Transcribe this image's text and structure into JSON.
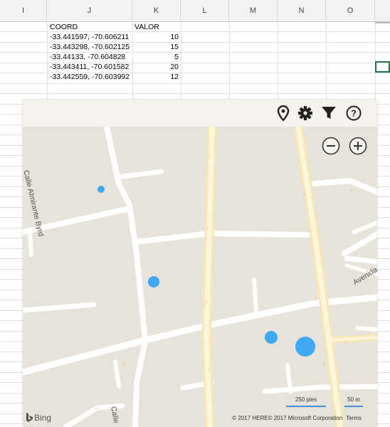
{
  "sheet": {
    "columns": [
      "I",
      "J",
      "K",
      "L",
      "M",
      "N",
      "O"
    ],
    "table": {
      "headers": [
        "COORD",
        "VALOR"
      ],
      "rows": [
        {
          "coord": "-33.441597, -70.606211",
          "valor": "10"
        },
        {
          "coord": "-33.443298, -70.602125",
          "valor": "15"
        },
        {
          "coord": "-33.44133, -70.604828",
          "valor": "5"
        },
        {
          "coord": "-33.443411, -70.601582",
          "valor": "20"
        },
        {
          "coord": "-33.442559, -70.603992",
          "valor": "12"
        }
      ]
    }
  },
  "map": {
    "toolbar_icons": [
      "map-pin-icon",
      "gear-icon",
      "filter-icon",
      "help-icon"
    ],
    "zoom_icons": [
      "zoom-out-icon",
      "zoom-in-icon"
    ],
    "street_labels": {
      "almirante": "Calle Almirante Byrd",
      "avenida": "Avenida D",
      "calle_bottom": "Calle"
    },
    "bubble_values": [
      10,
      15,
      5,
      20,
      12
    ],
    "scale": {
      "feet": "250 pies",
      "meters": "50 m"
    },
    "attribution": {
      "here": "© 2017 HERE",
      "microsoft": "© 2017 Microsoft Corporation",
      "terms": "Terms"
    },
    "logo": "Bing",
    "colors": {
      "bubble": "#3fa9f5",
      "land": "#e7e2da",
      "road": "#ffffff",
      "major_road": "#fbeec1",
      "accent": "#217346"
    }
  }
}
